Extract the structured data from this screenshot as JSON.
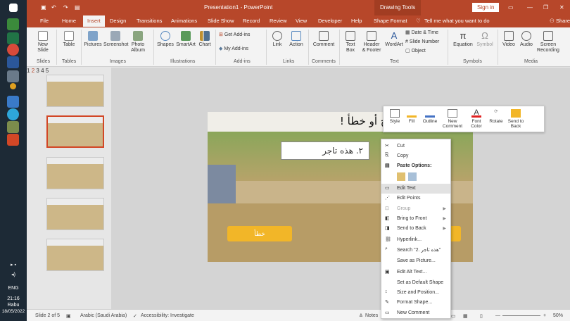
{
  "titlebar": {
    "title": "Presentation1 - PowerPoint",
    "drawing_tools": "Drawing Tools",
    "signin": "Sign in"
  },
  "tabs": [
    "File",
    "Home",
    "Insert",
    "Design",
    "Transitions",
    "Animations",
    "Slide Show",
    "Record",
    "Review",
    "View",
    "Developer",
    "Help",
    "Shape Format"
  ],
  "tell_me": "Tell me what you want to do",
  "share": "Share",
  "ribbon": {
    "new_slide": "New\nSlide",
    "table": "Table",
    "pictures": "Pictures",
    "screenshot": "Screenshot",
    "photo_album": "Photo\nAlbum",
    "shapes": "Shapes",
    "smartart": "SmartArt",
    "chart": "Chart",
    "get_addins": "Get Add-ins",
    "my_addins": "My Add-ins",
    "link": "Link",
    "action": "Action",
    "comment": "Comment",
    "text_box": "Text\nBox",
    "header_footer": "Header\n& Footer",
    "wordart": "WordArt",
    "date_time": "Date & Time",
    "slide_number": "Slide Number",
    "object": "Object",
    "equation": "Equation",
    "symbol": "Symbol",
    "video": "Video",
    "audio": "Audio",
    "screen_recording": "Screen\nRecording",
    "groups": [
      "Slides",
      "Tables",
      "Images",
      "Illustrations",
      "Add-ins",
      "Links",
      "Comments",
      "Text",
      "Symbols",
      "Media"
    ]
  },
  "thumbnails": [
    "1",
    "2",
    "3",
    "4",
    "5"
  ],
  "slide": {
    "title": "الجملة التالية صحيح أو خطأ !",
    "textbox": "٢. هذه تاجر",
    "button": "خطأ"
  },
  "mini_toolbar": [
    "Style",
    "Fill",
    "Outline",
    "New\nComment",
    "Font\nColor",
    "Rotate",
    "Send to\nBack"
  ],
  "context_menu": {
    "cut": "Cut",
    "copy": "Copy",
    "paste_options": "Paste Options:",
    "edit_text": "Edit Text",
    "edit_points": "Edit Points",
    "group": "Group",
    "bring_to_front": "Bring to Front",
    "send_to_back": "Send to Back",
    "hyperlink": "Hyperlink...",
    "search": "Search \"2. هذه تاجر\"",
    "save_as_picture": "Save as Picture...",
    "edit_alt_text": "Edit Alt Text...",
    "set_default_shape": "Set as Default Shape",
    "size_position": "Size and Position...",
    "format_shape": "Format Shape...",
    "new_comment": "New Comment"
  },
  "status": {
    "slide_of": "Slide 2 of 5",
    "language": "Arabic (Saudi Arabia)",
    "accessibility": "Accessibility: Investigate",
    "notes": "Notes",
    "zoom": "50%"
  },
  "taskbar": {
    "lang": "ENG",
    "time": "21:16",
    "day": "Rabu",
    "date": "18/05/2022"
  }
}
